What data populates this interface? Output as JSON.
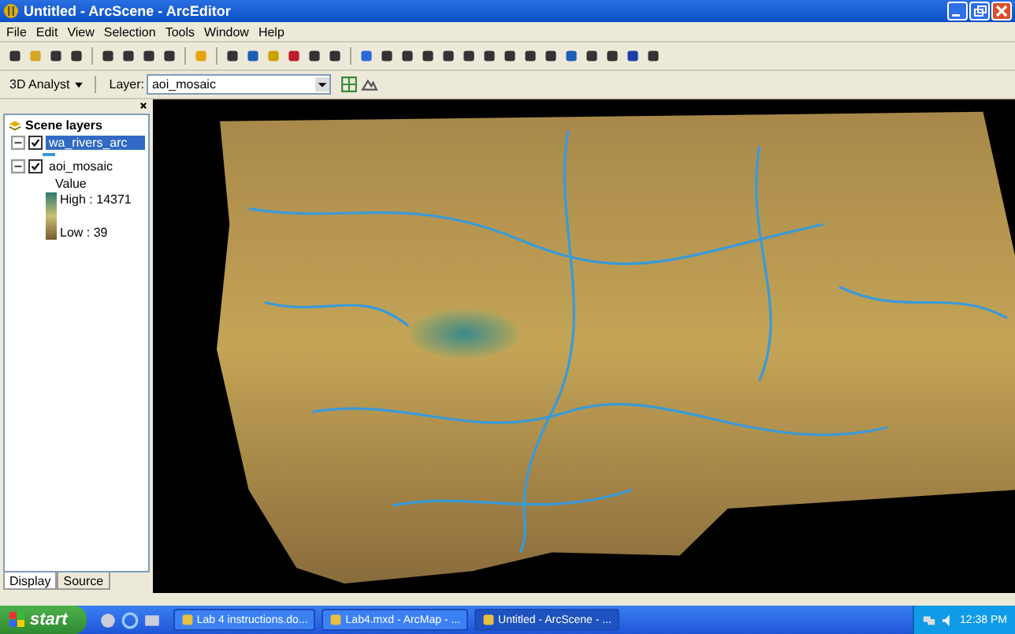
{
  "window": {
    "title": "Untitled - ArcScene - ArcEditor"
  },
  "menu": [
    "File",
    "Edit",
    "View",
    "Selection",
    "Tools",
    "Window",
    "Help"
  ],
  "toolbar": {
    "analyst": "3D Analyst",
    "layer_label": "Layer:",
    "layer_value": "aoi_mosaic"
  },
  "toc": {
    "title": "Scene layers",
    "layers": [
      {
        "name": "wa_rivers_arc",
        "checked": true,
        "selected": true,
        "expanded": true,
        "kind": "line"
      },
      {
        "name": "aoi_mosaic",
        "checked": true,
        "selected": false,
        "expanded": true,
        "kind": "raster",
        "legend_title": "Value",
        "high": "High : 14371",
        "low": "Low : 39"
      }
    ],
    "tabs": [
      {
        "label": "Display",
        "selected": true
      },
      {
        "label": "Source",
        "selected": false
      }
    ]
  },
  "taskbar": {
    "start": "start",
    "tasks": [
      {
        "label": "Lab 4 instructions.do...",
        "selected": false
      },
      {
        "label": "Lab4.mxd - ArcMap - ...",
        "selected": false
      },
      {
        "label": "Untitled - ArcScene - ...",
        "selected": true
      }
    ],
    "clock": "12:38 PM"
  }
}
